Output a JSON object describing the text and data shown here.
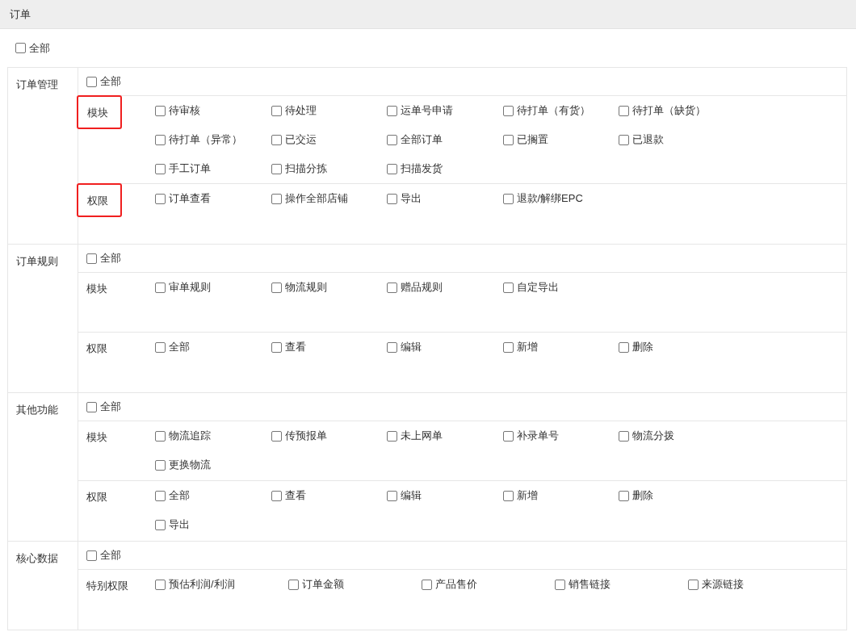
{
  "header": {
    "title": "订单"
  },
  "select_all": {
    "label": "全部",
    "checked": false
  },
  "groups": [
    {
      "name": "订单管理",
      "all": {
        "label": "全部",
        "checked": false
      },
      "sections": [
        {
          "label": "模块",
          "highlighted": true,
          "kind": "normal",
          "items": [
            {
              "label": "待审核",
              "checked": false
            },
            {
              "label": "待处理",
              "checked": false
            },
            {
              "label": "运单号申请",
              "checked": false
            },
            {
              "label": "待打单（有货）",
              "checked": false
            },
            {
              "label": "待打单（缺货）",
              "checked": false
            },
            {
              "label": "待打单（异常）",
              "checked": false
            },
            {
              "label": "已交运",
              "checked": false
            },
            {
              "label": "全部订单",
              "checked": false
            },
            {
              "label": "已搁置",
              "checked": false
            },
            {
              "label": "已退款",
              "checked": false
            },
            {
              "label": "手工订单",
              "checked": false
            },
            {
              "label": "扫描分拣",
              "checked": false
            },
            {
              "label": "扫描发货",
              "checked": false
            }
          ]
        },
        {
          "label": "权限",
          "highlighted": true,
          "kind": "normal",
          "items": [
            {
              "label": "订单查看",
              "checked": false
            },
            {
              "label": "操作全部店铺",
              "checked": false
            },
            {
              "label": "导出",
              "checked": false
            },
            {
              "label": "退款/解绑EPC",
              "checked": false
            }
          ]
        }
      ]
    },
    {
      "name": "订单规则",
      "all": {
        "label": "全部",
        "checked": false
      },
      "sections": [
        {
          "label": "模块",
          "highlighted": false,
          "kind": "normal",
          "items": [
            {
              "label": "审单规则",
              "checked": false
            },
            {
              "label": "物流规则",
              "checked": false
            },
            {
              "label": "赠品规则",
              "checked": false
            },
            {
              "label": "自定导出",
              "checked": false
            }
          ]
        },
        {
          "label": "权限",
          "highlighted": false,
          "kind": "normal",
          "items": [
            {
              "label": "全部",
              "checked": false
            },
            {
              "label": "查看",
              "checked": false
            },
            {
              "label": "编辑",
              "checked": false
            },
            {
              "label": "新增",
              "checked": false
            },
            {
              "label": "删除",
              "checked": false
            }
          ]
        }
      ]
    },
    {
      "name": "其他功能",
      "all": {
        "label": "全部",
        "checked": false
      },
      "sections": [
        {
          "label": "模块",
          "highlighted": false,
          "kind": "normal",
          "items": [
            {
              "label": "物流追踪",
              "checked": false
            },
            {
              "label": "传预报单",
              "checked": false
            },
            {
              "label": "未上网单",
              "checked": false
            },
            {
              "label": "补录单号",
              "checked": false
            },
            {
              "label": "物流分拨",
              "checked": false
            },
            {
              "label": "更换物流",
              "checked": false
            }
          ]
        },
        {
          "label": "权限",
          "highlighted": false,
          "kind": "normal",
          "items": [
            {
              "label": "全部",
              "checked": false
            },
            {
              "label": "查看",
              "checked": false
            },
            {
              "label": "编辑",
              "checked": false
            },
            {
              "label": "新增",
              "checked": false
            },
            {
              "label": "删除",
              "checked": false
            },
            {
              "label": "导出",
              "checked": false
            }
          ]
        }
      ]
    },
    {
      "name": "核心数据",
      "all": {
        "label": "全部",
        "checked": false
      },
      "sections": [
        {
          "label": "特别权限",
          "highlighted": false,
          "kind": "wide",
          "items": [
            {
              "label": "预估利润/利润",
              "checked": false
            },
            {
              "label": "订单金额",
              "checked": false
            },
            {
              "label": "产品售价",
              "checked": false
            },
            {
              "label": "销售链接",
              "checked": false
            },
            {
              "label": "来源链接",
              "checked": false
            }
          ]
        }
      ]
    }
  ]
}
